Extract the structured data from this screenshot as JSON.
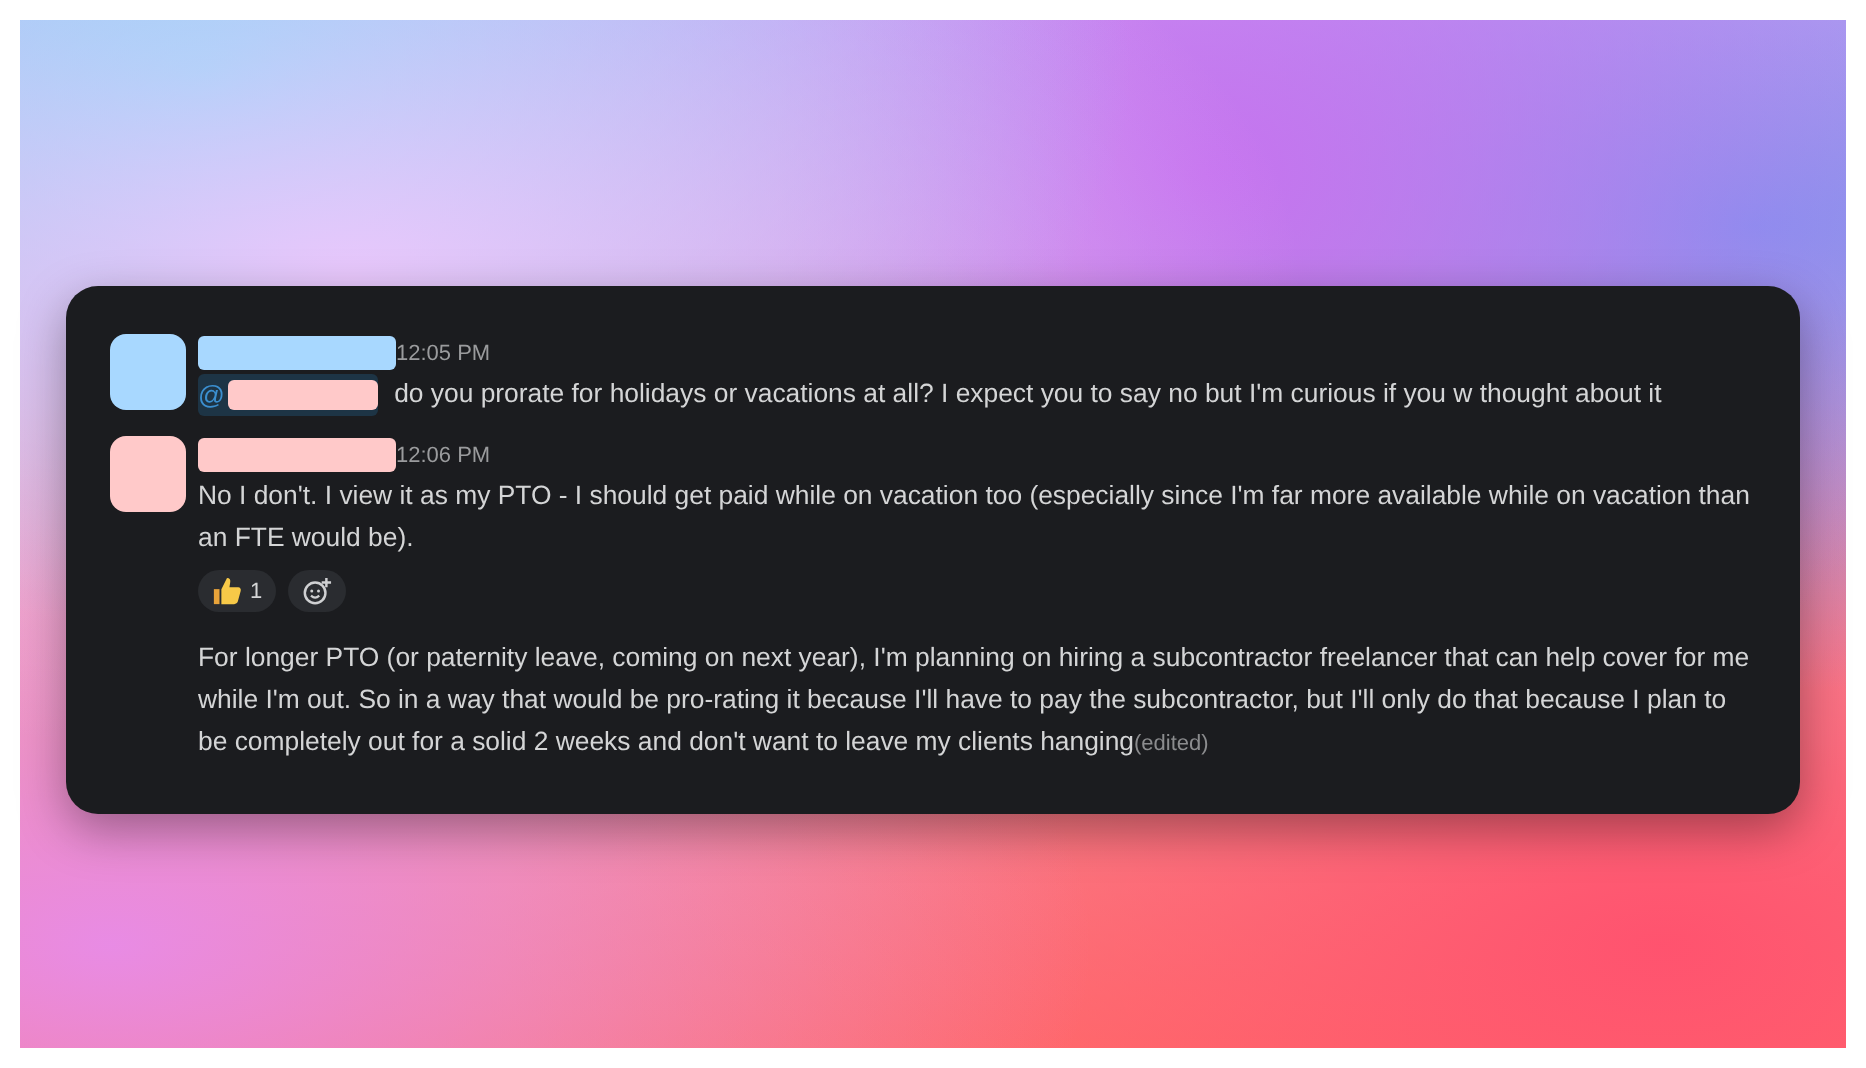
{
  "messages": [
    {
      "color": "#a8d8ff",
      "time": "12:05 PM",
      "mention": {
        "symbol": "@",
        "color": "#ffc9c9"
      },
      "text": "do you prorate for holidays or vacations at all? I expect you to say no but I'm curious if you w thought about it"
    },
    {
      "color": "#ffc9c9",
      "time": "12:06 PM",
      "text": "No I don't. I view it as my PTO - I should get paid while on vacation too (especially since I'm far more available while on vacation than an FTE would be).",
      "reactions": [
        {
          "kind": "thumbs-up",
          "count": "1"
        },
        {
          "kind": "add"
        }
      ]
    },
    {
      "text": "For longer PTO (or paternity leave, coming on next year), I'm planning on hiring a subcontractor freelancer that can help cover for me while I'm out. So in a way that would be pro-rating it because I'll have to pay the subcontractor, but I'll only do that because I plan to be completely out for a solid 2 weeks and don't want to leave my clients hanging",
      "edited": "(edited)"
    }
  ]
}
